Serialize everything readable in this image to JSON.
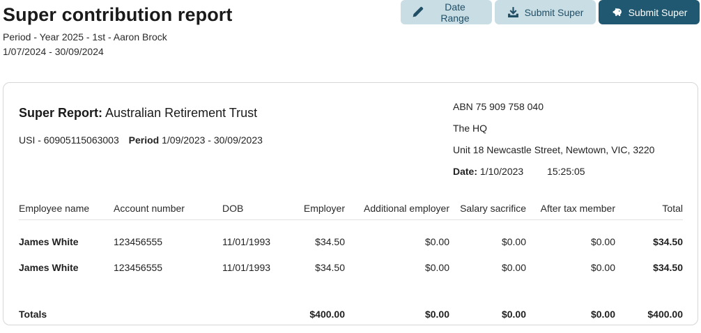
{
  "header": {
    "title": "Super contribution report",
    "period": "Period - Year 2025 - 1st - Aaron Brock",
    "date_range": "1/07/2024 - 30/09/2024"
  },
  "toolbar": {
    "date_range_label": "Date Range",
    "date_range_icon": "pencil-icon",
    "submit_super_label": "Submit Super",
    "submit_super_icon": "download-icon",
    "submit_super_primary_label": "Submit Super",
    "submit_super_primary_icon": "piggy-bank-icon",
    "colors": {
      "light_bg": "#c9dde5",
      "light_text": "#1f4e65",
      "dark_bg": "#1f5870"
    }
  },
  "report": {
    "title_label": "Super Report:",
    "fund_name": "Australian Retirement Trust",
    "usi": "USI - 60905115063003",
    "period_label": "Period",
    "period_value": "1/09/2023 - 30/09/2023",
    "abn": "ABN 75 909 758 040",
    "company": "The HQ",
    "address": "Unit 18 Newcastle Street, Newtown, VIC, 3220",
    "date_label": "Date:",
    "date_value": "1/10/2023",
    "time_value": "15:25:05"
  },
  "table": {
    "columns": [
      "Employee name",
      "Account number",
      "DOB",
      "Employer",
      "Additional employer",
      "Salary sacrifice",
      "After tax member",
      "Total"
    ],
    "rows": [
      [
        "James White",
        "123456555",
        "11/01/1993",
        "$34.50",
        "$0.00",
        "$0.00",
        "$0.00",
        "$34.50"
      ],
      [
        "James White",
        "123456555",
        "11/01/1993",
        "$34.50",
        "$0.00",
        "$0.00",
        "$0.00",
        "$34.50"
      ]
    ],
    "totals": {
      "label": "Totals",
      "employer": "$400.00",
      "additional_employer": "$0.00",
      "salary_sacrifice": "$0.00",
      "after_tax_member": "$0.00",
      "total": "$400.00"
    }
  }
}
